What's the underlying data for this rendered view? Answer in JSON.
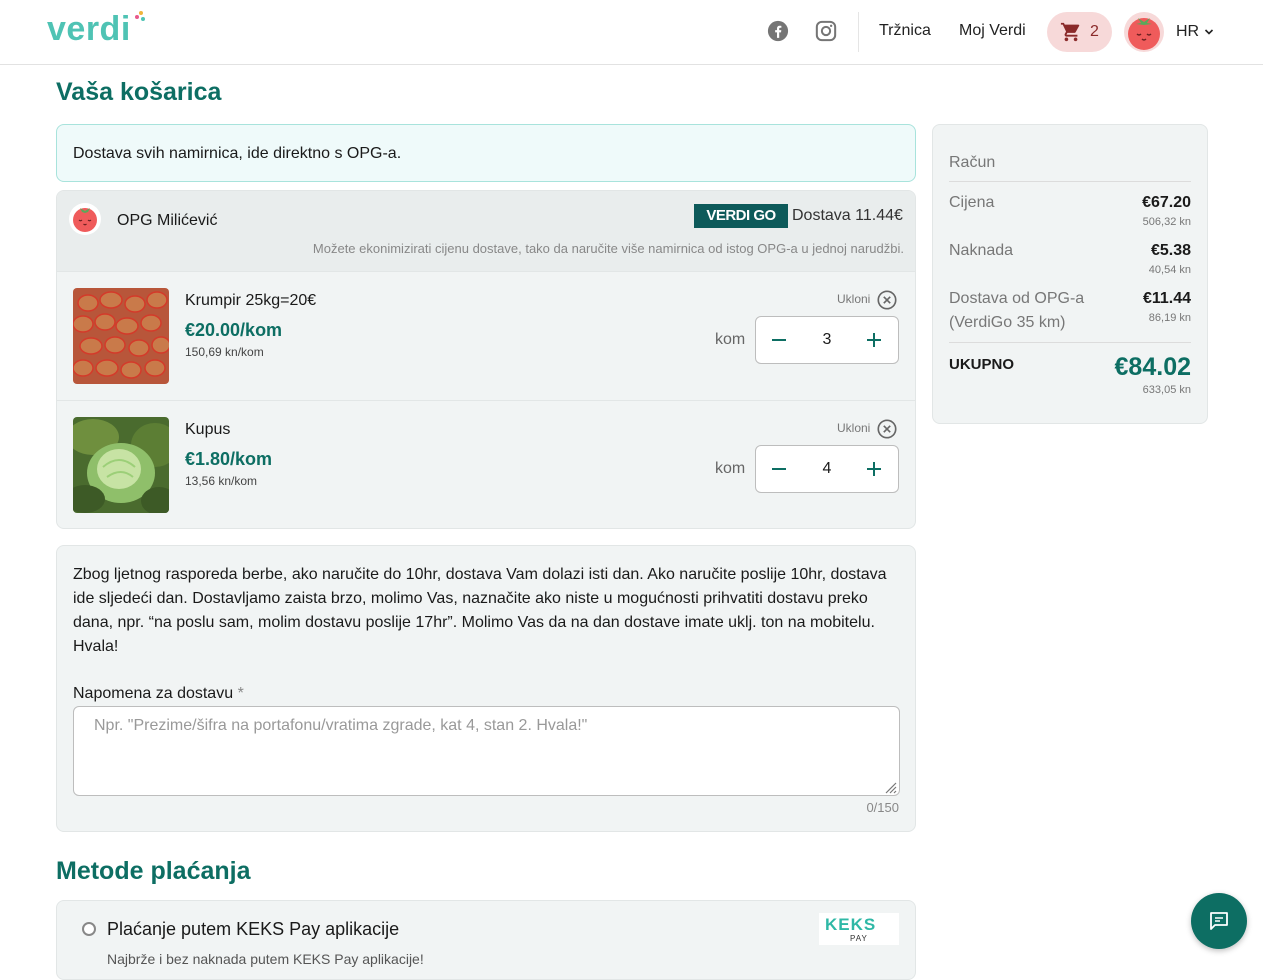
{
  "header": {
    "logo_text": "verdi",
    "nav": [
      {
        "label": "Tržnica"
      },
      {
        "label": "Moj Verdi"
      }
    ],
    "cart_count": "2",
    "language": "HR"
  },
  "page_title": "Vaša košarica",
  "info_banner": "Dostava svih namirnica, ide direktno s OPG-a.",
  "vendor": {
    "name": "OPG Milićević",
    "delivery_badge": "VERDI GO",
    "delivery_text": "Dostava 11.44€",
    "delivery_note": "Možete ekonimizirati cijenu dostave, tako da naručite više namirnica od istog OPG-a u jednoj narudžbi.",
    "items": [
      {
        "name": "Krumpir 25kg=20€",
        "price": "€20.00/kom",
        "price_kn": "150,69 kn/kom",
        "remove_label": "Ukloni",
        "unit": "kom",
        "quantity": "3"
      },
      {
        "name": "Kupus",
        "price": "€1.80/kom",
        "price_kn": "13,56 kn/kom",
        "remove_label": "Ukloni",
        "unit": "kom",
        "quantity": "4"
      }
    ]
  },
  "delivery_note": {
    "info": "Zbog ljetnog rasporeda berbe, ako naručite do 10hr, dostava Vam dolazi isti dan. Ako naručite poslije 10hr, dostava ide sljedeći dan. Dostavljamo zaista brzo, molimo Vas, naznačite ako niste u mogućnosti prihvatiti dostavu preko dana, npr. “na poslu sam, molim dostavu poslije 17hr”. Molimo Vas da na dan dostave imate uklj. ton na mobitelu. Hvala!",
    "label": "Napomena za dostavu",
    "required_mark": "*",
    "placeholder": "Npr. \"Prezime/šifra na portafonu/vratima zgrade, kat 4, stan 2. Hvala!\"",
    "value": "",
    "counter": "0/150"
  },
  "payment": {
    "title": "Metode plaćanja",
    "methods": [
      {
        "name": "Plaćanje putem KEKS Pay aplikacije",
        "description": "Najbrže i bez naknada putem KEKS Pay aplikacije!",
        "logo_text": "KEKS",
        "logo_sub": "PAY"
      }
    ]
  },
  "bill": {
    "title": "Račun",
    "rows": [
      {
        "label": "Cijena",
        "value": "€67.20",
        "kn": "506,32 kn"
      },
      {
        "label": "Naknada",
        "value": "€5.38",
        "kn": "40,54 kn"
      },
      {
        "label": "Dostava od OPG-a (VerdiGo 35 km)",
        "value": "€11.44",
        "kn": "86,19 kn"
      }
    ],
    "total_label": "UKUPNO",
    "total": "€84.02",
    "total_kn": "633,05 kn"
  },
  "colors": {
    "brand_teal": "#0d6e63",
    "logo_teal": "#4fc3b4",
    "cart_bg": "#f7d9d9",
    "card_bg": "#f1f4f4"
  },
  "icons": [
    "facebook-icon",
    "instagram-icon",
    "cart-icon",
    "avatar-tomato-icon",
    "chevron-down-icon",
    "close-circle-icon",
    "minus-icon",
    "plus-icon",
    "chat-icon"
  ]
}
